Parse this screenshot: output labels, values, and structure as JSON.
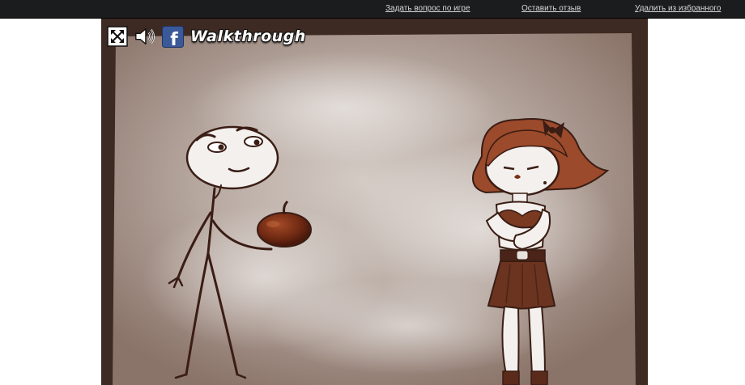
{
  "topbar": {
    "links": [
      {
        "label": "Задать вопрос по игре"
      },
      {
        "label": "Оставить отзыв"
      },
      {
        "label": "Удалить из избранного"
      }
    ]
  },
  "game": {
    "hud": {
      "icons": [
        "fullscreen-icon",
        "sound-icon",
        "facebook-icon"
      ],
      "facebook_glyph": "f",
      "walkthrough_label": "Walkthrough"
    },
    "colors": {
      "frame": "#3d2a22",
      "background": "#b8aaa2",
      "ink": "#3a1d14",
      "apple": "#7a2e17",
      "hair": "#9b4a2b",
      "skirt": "#6b3420",
      "facebook": "#3b5998"
    }
  }
}
